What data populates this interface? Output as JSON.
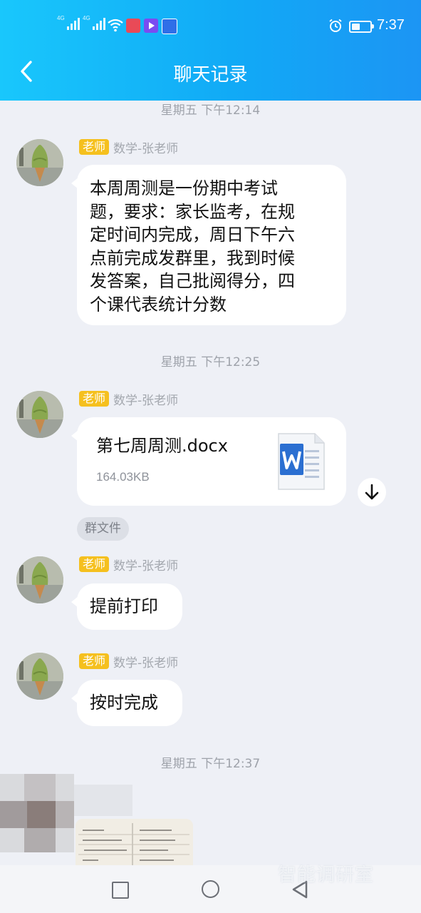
{
  "status_bar": {
    "sig1_label": "4G",
    "sig2_label": "4G",
    "app_icons": [
      "app-icon-red",
      "app-icon-purple",
      "app-icon-blue"
    ],
    "time": "7:37"
  },
  "header": {
    "title": "聊天记录",
    "back_icon": "chevron-left-icon"
  },
  "messages": [
    {
      "timestamp": "星期五 下午12:14",
      "role": "老师",
      "sender": "数学-张老师",
      "lines": [
        "本周周测是一份期中考试",
        "题，要求：家长监考，在规",
        "定时间内完成，周日下午六",
        "点前完成发群里，我到时候",
        "发答案，自己批阅得分，四",
        "个课代表统计分数"
      ]
    },
    {
      "timestamp": "星期五 下午12:25",
      "role": "老师",
      "sender": "数学-张老师",
      "file": {
        "name": "第七周周测.docx",
        "size": "164.03KB",
        "icon": "word-doc-icon",
        "tag": "群文件"
      }
    },
    {
      "role": "老师",
      "sender": "数学-张老师",
      "text": "提前打印"
    },
    {
      "role": "老师",
      "sender": "数学-张老师",
      "text": "按时完成"
    },
    {
      "timestamp": "星期五 下午12:37"
    }
  ],
  "nav": {
    "recent_icon": "square-icon",
    "home_icon": "circle-icon",
    "back_icon": "triangle-back-icon"
  },
  "watermark": "智能调研室"
}
